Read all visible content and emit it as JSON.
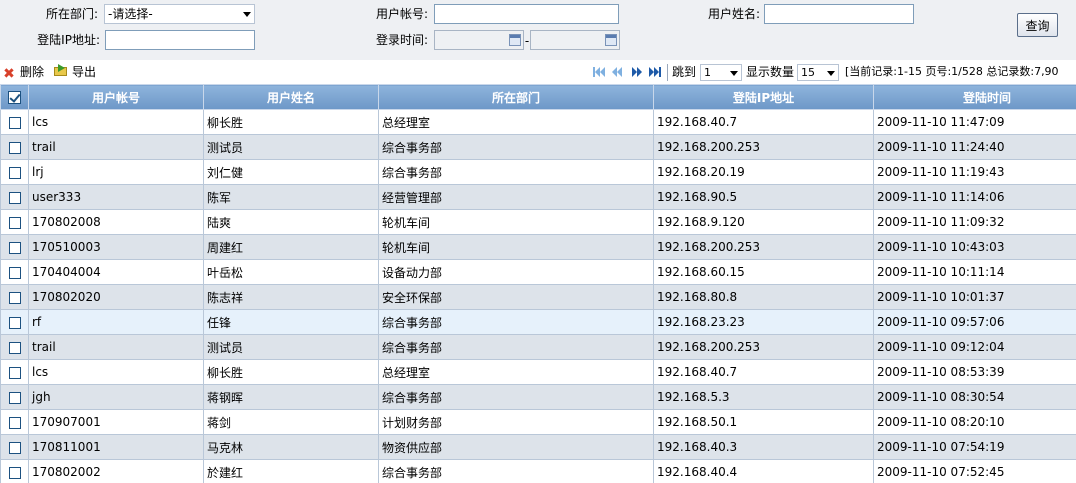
{
  "filters": {
    "department_label": "所在部门:",
    "department_value": "-请选择-",
    "account_label": "用户帐号:",
    "account_value": "",
    "username_label": "用户姓名:",
    "username_value": "",
    "ip_label": "登陆IP地址:",
    "ip_value": "",
    "login_time_label": "登录时间:",
    "date_separator": "-",
    "query_button": "查询"
  },
  "toolbar": {
    "delete_label": "删除",
    "export_label": "导出"
  },
  "pager": {
    "jump_label": "跳到",
    "page_select": "1",
    "count_label": "显示数量",
    "count_select": "15",
    "status_text": "[当前记录:1-15 页号:1/528 总记录数:7,90"
  },
  "columns": [
    "用户帐号",
    "用户姓名",
    "所在部门",
    "登陆IP地址",
    "登陆时间"
  ],
  "rows": [
    {
      "account": "lcs",
      "name": "柳长胜",
      "dept": "总经理室",
      "ip": "192.168.40.7",
      "time": "2009-11-10 11:47:09"
    },
    {
      "account": "trail",
      "name": "测试员",
      "dept": "综合事务部",
      "ip": "192.168.200.253",
      "time": "2009-11-10 11:24:40"
    },
    {
      "account": "lrj",
      "name": "刘仁健",
      "dept": "综合事务部",
      "ip": "192.168.20.19",
      "time": "2009-11-10 11:19:43"
    },
    {
      "account": "user333",
      "name": "陈军",
      "dept": "经营管理部",
      "ip": "192.168.90.5",
      "time": "2009-11-10 11:14:06"
    },
    {
      "account": "170802008",
      "name": "陆爽",
      "dept": "轮机车间",
      "ip": "192.168.9.120",
      "time": "2009-11-10 11:09:32"
    },
    {
      "account": "170510003",
      "name": "周建红",
      "dept": "轮机车间",
      "ip": "192.168.200.253",
      "time": "2009-11-10 10:43:03"
    },
    {
      "account": "170404004",
      "name": "叶岳松",
      "dept": "设备动力部",
      "ip": "192.168.60.15",
      "time": "2009-11-10 10:11:14"
    },
    {
      "account": "170802020",
      "name": "陈志祥",
      "dept": "安全环保部",
      "ip": "192.168.80.8",
      "time": "2009-11-10 10:01:37"
    },
    {
      "account": "rf",
      "name": "任锋",
      "dept": "综合事务部",
      "ip": "192.168.23.23",
      "time": "2009-11-10 09:57:06"
    },
    {
      "account": "trail",
      "name": "测试员",
      "dept": "综合事务部",
      "ip": "192.168.200.253",
      "time": "2009-11-10 09:12:04"
    },
    {
      "account": "lcs",
      "name": "柳长胜",
      "dept": "总经理室",
      "ip": "192.168.40.7",
      "time": "2009-11-10 08:53:39"
    },
    {
      "account": "jgh",
      "name": "蒋钢晖",
      "dept": "综合事务部",
      "ip": "192.168.5.3",
      "time": "2009-11-10 08:30:54"
    },
    {
      "account": "170907001",
      "name": "蒋剑",
      "dept": "计划财务部",
      "ip": "192.168.50.1",
      "time": "2009-11-10 08:20:10"
    },
    {
      "account": "170811001",
      "name": "马克林",
      "dept": "物资供应部",
      "ip": "192.168.40.3",
      "time": "2009-11-10 07:54:19"
    },
    {
      "account": "170802002",
      "name": "於建红",
      "dept": "综合事务部",
      "ip": "192.168.40.4",
      "time": "2009-11-10 07:52:45"
    }
  ],
  "colors": {
    "header_blue": "#7aa3d0",
    "row_alt": "#dde3ea",
    "row_highlight": "#e6f1fb",
    "delete_red": "#d8402a",
    "nav_blue": "#1e5aa8"
  },
  "icons": {
    "delete": "delete-x-icon",
    "export": "export-folder-icon",
    "first": "first-page-icon",
    "prev": "prev-page-icon",
    "next": "next-page-icon",
    "last": "last-page-icon",
    "calendar": "calendar-icon",
    "select_all": "select-all-checkbox"
  }
}
